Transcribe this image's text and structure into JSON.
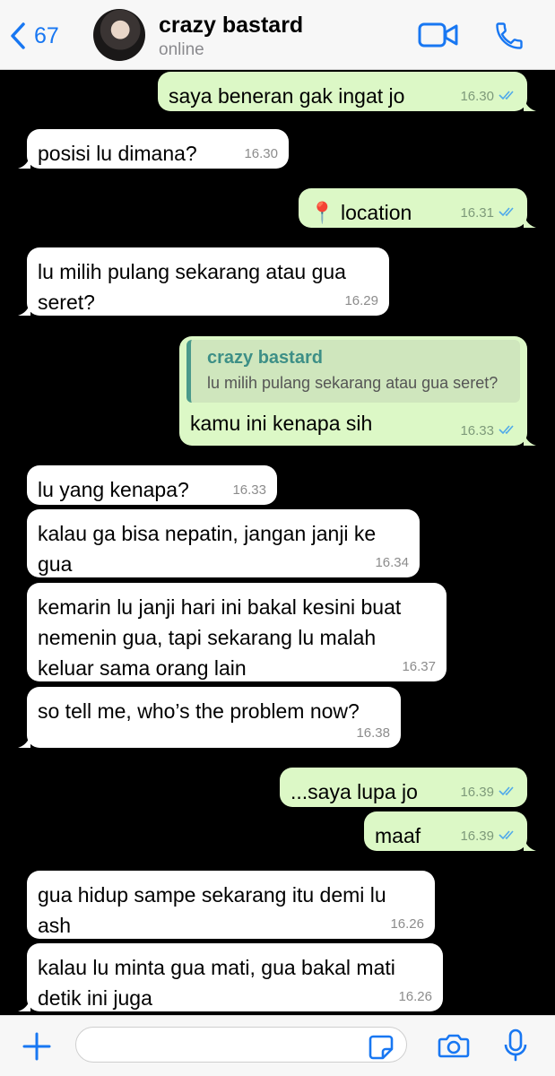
{
  "header": {
    "back_count": "67",
    "contact_name": "crazy bastard",
    "status": "online"
  },
  "messages": [
    {
      "dir": "out",
      "text": "saya beneran gak ingat jo",
      "time": "16.30",
      "read": true
    },
    {
      "dir": "in",
      "text": "posisi lu dimana?",
      "time": "16.30"
    },
    {
      "dir": "out",
      "text": "📍 location",
      "time": "16.31",
      "read": true
    },
    {
      "dir": "in",
      "text": "lu milih pulang sekarang atau gua seret?",
      "time": "16.29"
    },
    {
      "dir": "out",
      "quote": {
        "name": "crazy bastard",
        "text": "lu milih pulang sekarang atau gua seret?"
      },
      "text": "kamu ini kenapa sih",
      "time": "16.33",
      "read": true
    },
    {
      "dir": "in",
      "text": "lu yang kenapa?",
      "time": "16.33"
    },
    {
      "dir": "in",
      "text": "kalau ga bisa nepatin, jangan janji ke gua",
      "time": "16.34"
    },
    {
      "dir": "in",
      "text": "kemarin lu janji hari ini bakal kesini buat nemenin gua, tapi sekarang lu malah keluar sama orang lain",
      "time": "16.37"
    },
    {
      "dir": "in",
      "text": "so tell me, who’s the problem now?",
      "time": "16.38"
    },
    {
      "dir": "out",
      "text": "...saya lupa jo",
      "time": "16.39",
      "read": true
    },
    {
      "dir": "out",
      "text": "maaf",
      "time": "16.39",
      "read": true
    },
    {
      "dir": "in",
      "text": "gua hidup sampe sekarang itu demi lu ash",
      "time": "16.26"
    },
    {
      "dir": "in",
      "text": "kalau lu minta gua mati, gua bakal mati detik ini juga",
      "time": "16.26"
    }
  ],
  "composer": {
    "placeholder": ""
  },
  "icons": {
    "back": "chevron-left-icon",
    "video": "video-call-icon",
    "phone": "phone-icon",
    "plus": "plus-icon",
    "sticker": "sticker-icon",
    "camera": "camera-icon",
    "mic": "microphone-icon"
  },
  "colors": {
    "accent": "#1877f2",
    "incoming_bubble": "#ffffff",
    "outgoing_bubble": "#dcf8c6",
    "background": "#000000",
    "read_ticks": "#4fa9ea"
  }
}
